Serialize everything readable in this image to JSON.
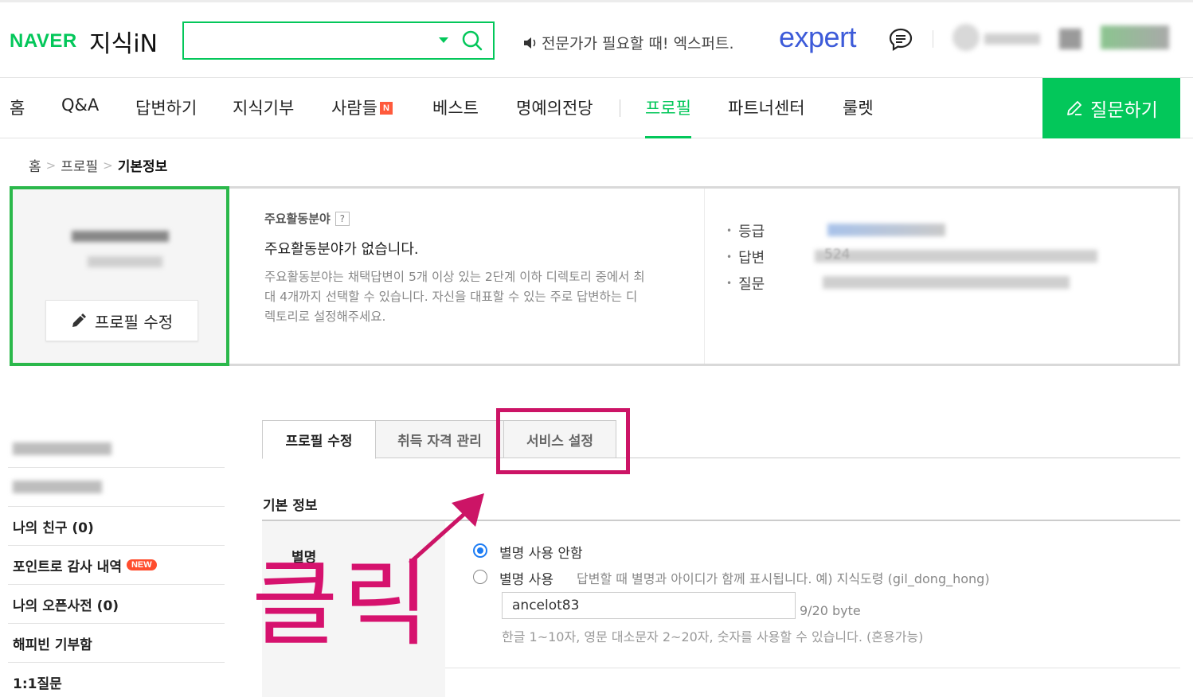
{
  "header": {
    "logo_naver": "NAVER",
    "logo_service": "지식iN",
    "search_value": "",
    "promo_text": "전문가가 필요할 때! 엑스퍼트.",
    "expert_logo": "expert",
    "brand_color": "#03c75a",
    "expert_color": "#3d5bd9"
  },
  "nav": {
    "items": [
      "홈",
      "Q&A",
      "답변하기",
      "지식기부",
      "사람들",
      "베스트",
      "명예의전당",
      "프로필",
      "파트너센터",
      "룰렛"
    ],
    "new_badge": "N",
    "active_item": "프로필",
    "ask_button": "질문하기"
  },
  "breadcrumb": [
    "홈",
    "프로필",
    "기본정보"
  ],
  "profile": {
    "edit_button": "프로필 수정",
    "field_title": "주요활동분야",
    "help_mark": "?",
    "field_empty": "주요활동분야가 없습니다.",
    "field_desc": "주요활동분야는 채택답변이 5개 이상 있는 2단계 이하 디렉토리 중에서 최대 4개까지 선택할 수 있습니다. 자신을 대표할 수 있는 주로 답변하는 디렉토리로 설정해주세요.",
    "stats": [
      "등급",
      "답변",
      "질문"
    ],
    "answer_count_partial": "524"
  },
  "sidebar": {
    "items": [
      "나의 친구 (0)",
      "포인트로 감사 내역",
      "나의 오픈사전 (0)",
      "해피빈 기부함",
      "1:1질문"
    ],
    "new_badge": "NEW"
  },
  "tabs": {
    "items": [
      "프로필 수정",
      "취득 자격 관리",
      "서비스 설정"
    ],
    "active": "프로필 수정"
  },
  "basic_info": {
    "section_title": "기본 정보",
    "alias_label": "별명",
    "option_off": "별명 사용 안함",
    "option_on": "별명 사용",
    "option_on_desc": "답변할 때 별명과 아이디가 함께 표시됩니다. 예) 지식도령 (gil_dong_hong)",
    "alias_value": "ancelot83",
    "byte_count": "9/20 byte",
    "hint": "한글 1~10자, 영문 대소문자 2~20자, 숫자를 사용할 수 있습니다. (혼용가능)",
    "selected_option": "별명 사용 안함"
  },
  "annotation": {
    "text": "클릭",
    "color": "#cc1466"
  }
}
